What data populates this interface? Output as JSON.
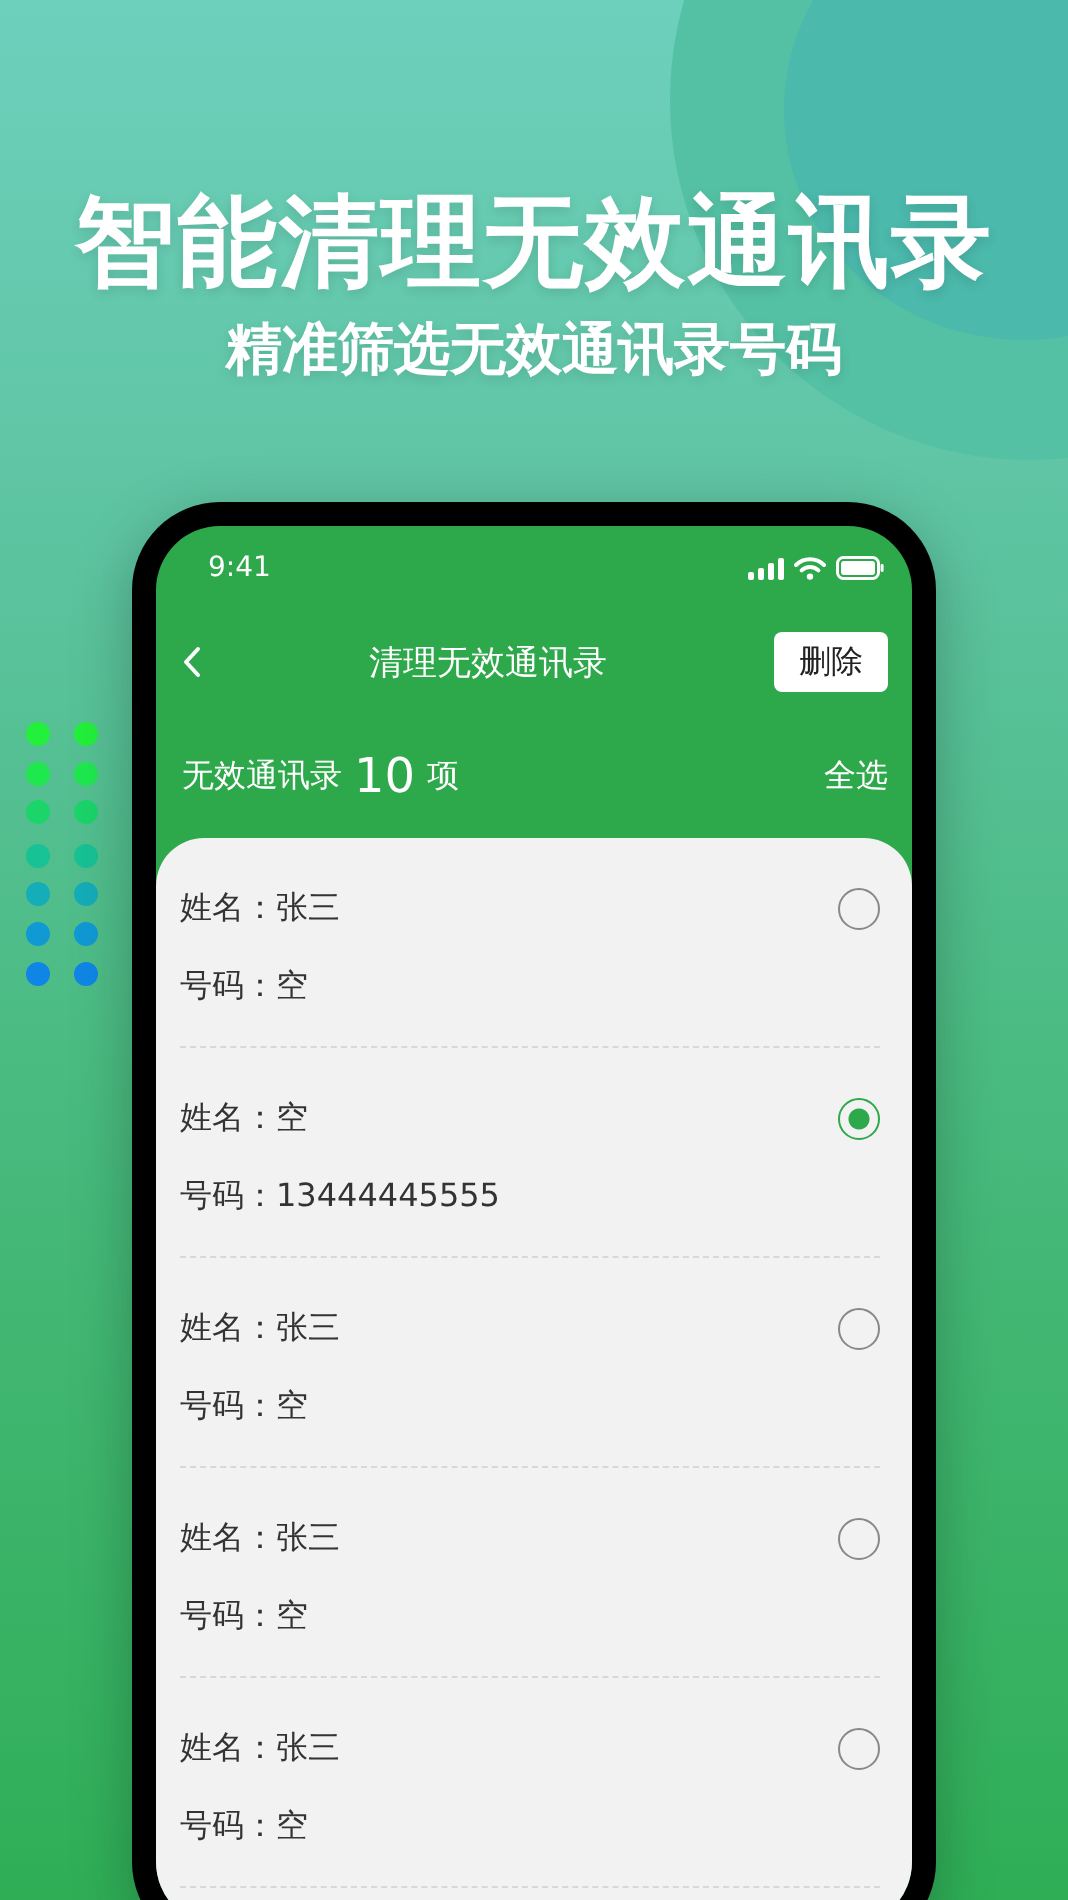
{
  "headline": "智能清理无效通讯录",
  "subtitle": "精准筛选无效通讯录号码",
  "phone": {
    "status_bar": {
      "time": "9:41"
    },
    "nav": {
      "title": "清理无效通讯录",
      "action": "删除"
    },
    "summary": {
      "label": "无效通讯录",
      "count": "10",
      "unit": "项",
      "select_all": "全选"
    },
    "contacts": [
      {
        "name": "姓名：张三",
        "number": "号码：空",
        "selected": false
      },
      {
        "name": "姓名：空",
        "number": "号码：13444445555",
        "selected": true
      },
      {
        "name": "姓名：张三",
        "number": "号码：空",
        "selected": false
      },
      {
        "name": "姓名：张三",
        "number": "号码：空",
        "selected": false
      },
      {
        "name": "姓名：张三",
        "number": "号码：空",
        "selected": false
      }
    ]
  }
}
